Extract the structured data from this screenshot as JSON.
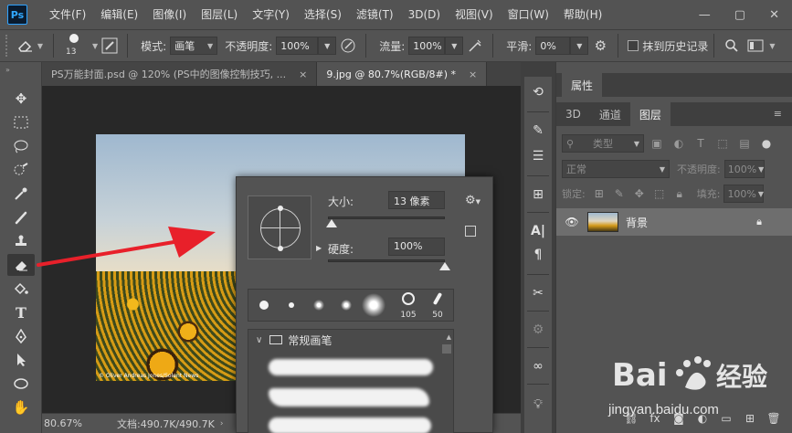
{
  "app": {
    "logo": "Ps"
  },
  "menu": [
    "文件(F)",
    "编辑(E)",
    "图像(I)",
    "图层(L)",
    "文字(Y)",
    "选择(S)",
    "滤镜(T)",
    "3D(D)",
    "视图(V)",
    "窗口(W)",
    "帮助(H)"
  ],
  "window": {
    "minimize": "—",
    "restore": "▢",
    "close": "✕"
  },
  "options": {
    "brush_size": "13",
    "mode_label": "模式:",
    "mode_value": "画笔",
    "opacity_label": "不透明度:",
    "opacity_value": "100%",
    "flow_label": "流量:",
    "flow_value": "100%",
    "smooth_label": "平滑:",
    "smooth_value": "0%",
    "erase_history_label": "抹到历史记录"
  },
  "tabs": [
    {
      "label": "PS万能封面.psd @ 120% (PS中的图像控制技巧, ...",
      "close": "×"
    },
    {
      "label": "9.jpg @ 80.7%(RGB/8#) *",
      "close": "×"
    }
  ],
  "photo": {
    "credit": "© Oliver Andreas Jones/Solent News"
  },
  "status": {
    "zoom": "80.67%",
    "doc": "文档:490.7K/490.7K",
    "arrow": "›"
  },
  "brush_popup": {
    "size_label": "大小:",
    "size_value": "13 像素",
    "size_fraction": 0.03,
    "hardness_label": "硬度:",
    "hardness_value": "100%",
    "hardness_fraction": 1.0,
    "preset_numbers": [
      "105",
      "50"
    ],
    "group_label": "常规画笔"
  },
  "properties": {
    "tab": "属性"
  },
  "layers": {
    "tabs": [
      "3D",
      "通道",
      "图层"
    ],
    "filter_label": "类型",
    "blend_mode": "正常",
    "opacity_label": "不透明度:",
    "opacity_value": "100%",
    "lock_label": "锁定:",
    "fill_label": "填充:",
    "fill_value": "100%",
    "layer_name": "背景"
  },
  "watermark": {
    "text": "jingyan.baidu.com",
    "logo": "Bai经验"
  },
  "colors": {
    "accent_red": "#e8202a",
    "panel_bg": "#535353",
    "selected_layer": "#6e6e6e"
  }
}
